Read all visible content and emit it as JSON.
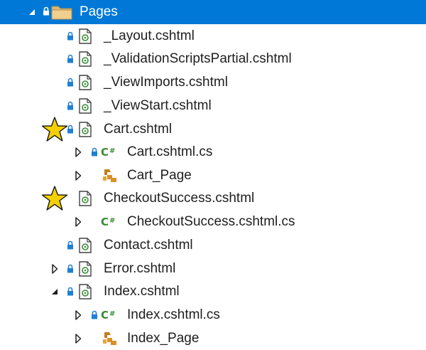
{
  "tree": {
    "root": {
      "label": "Pages",
      "expanded": true,
      "selected": true
    },
    "items": [
      {
        "label": "_Layout.cshtml",
        "icon": "cshtml-file-icon",
        "lock": true
      },
      {
        "label": "_ValidationScriptsPartial.cshtml",
        "icon": "cshtml-file-icon",
        "lock": true
      },
      {
        "label": "_ViewImports.cshtml",
        "icon": "cshtml-file-icon",
        "lock": true
      },
      {
        "label": "_ViewStart.cshtml",
        "icon": "cshtml-file-icon",
        "lock": true
      },
      {
        "label": "Cart.cshtml",
        "icon": "cshtml-file-icon",
        "lock": true,
        "starred": true,
        "expanded": true
      },
      {
        "label": "Cart.cshtml.cs",
        "icon": "csharp-file-icon",
        "lock": true,
        "collapsed": true
      },
      {
        "label": "Cart_Page",
        "icon": "class-icon",
        "collapsed": true
      },
      {
        "label": "CheckoutSuccess.cshtml",
        "icon": "cshtml-file-icon",
        "lock": false,
        "starred": true,
        "expanded": true
      },
      {
        "label": "CheckoutSuccess.cshtml.cs",
        "icon": "csharp-file-icon",
        "collapsed": true
      },
      {
        "label": "Contact.cshtml",
        "icon": "cshtml-file-icon",
        "lock": true
      },
      {
        "label": "Error.cshtml",
        "icon": "cshtml-file-icon",
        "lock": true,
        "collapsed": true
      },
      {
        "label": "Index.cshtml",
        "icon": "cshtml-file-icon",
        "lock": true,
        "expanded": true
      },
      {
        "label": "Index.cshtml.cs",
        "icon": "csharp-file-icon",
        "lock": true,
        "collapsed": true
      },
      {
        "label": "Index_Page",
        "icon": "class-icon",
        "collapsed": true
      }
    ]
  },
  "colors": {
    "selection": "#0078d7",
    "lock": "#1e7fd6",
    "csharp": "#388a34",
    "folder": "#dcb67a",
    "star": "#f5d000",
    "class_icon": "#c27d1a"
  }
}
